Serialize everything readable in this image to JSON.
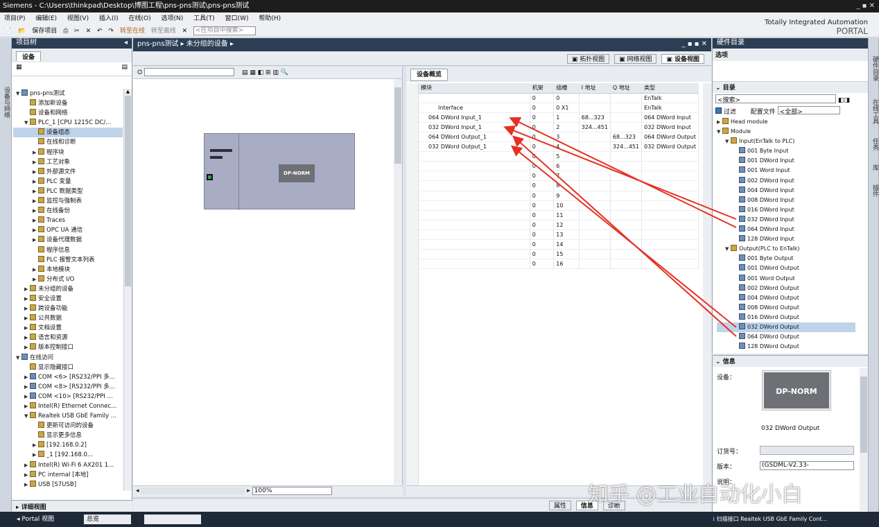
{
  "app": {
    "title": "Siemens  -  C:\\Users\\thinkpad\\Desktop\\博图工程\\pns-pns测试\\pns-pns测试",
    "window_controls": "_ ▪ ✕",
    "brand_line1": "Totally Integrated Automation",
    "brand_line2": "PORTAL"
  },
  "menu": [
    "项目(P)",
    "编辑(E)",
    "视图(V)",
    "插入(I)",
    "在线(O)",
    "选项(N)",
    "工具(T)",
    "窗口(W)",
    "帮助(H)"
  ],
  "toolbar": {
    "save": "保存项目",
    "go_online": "转至在线",
    "go_offline": "转至离线",
    "search_placeholder": "<在项目中搜索>"
  },
  "project_tree": {
    "header": "项目树",
    "tab": "设备",
    "items": [
      {
        "label": "pns-pns测试",
        "level": 0,
        "exp": "▼"
      },
      {
        "label": "添加新设备",
        "level": 1,
        "exp": ""
      },
      {
        "label": "设备和网络",
        "level": 1,
        "exp": ""
      },
      {
        "label": "PLC_1 [CPU 1215C DC/...",
        "level": 1,
        "exp": "▼"
      },
      {
        "label": "设备组态",
        "level": 2,
        "exp": "",
        "sel": true
      },
      {
        "label": "在线和诊断",
        "level": 2,
        "exp": ""
      },
      {
        "label": "程序块",
        "level": 2,
        "exp": "▶"
      },
      {
        "label": "工艺对象",
        "level": 2,
        "exp": "▶"
      },
      {
        "label": "外部源文件",
        "level": 2,
        "exp": "▶"
      },
      {
        "label": "PLC 变量",
        "level": 2,
        "exp": "▶"
      },
      {
        "label": "PLC 数据类型",
        "level": 2,
        "exp": "▶"
      },
      {
        "label": "监控与强制表",
        "level": 2,
        "exp": "▶"
      },
      {
        "label": "在线备份",
        "level": 2,
        "exp": "▶"
      },
      {
        "label": "Traces",
        "level": 2,
        "exp": "▶"
      },
      {
        "label": "OPC UA 通信",
        "level": 2,
        "exp": "▶"
      },
      {
        "label": "设备代理数据",
        "level": 2,
        "exp": "▶"
      },
      {
        "label": "程序信息",
        "level": 2,
        "exp": ""
      },
      {
        "label": "PLC 报警文本列表",
        "level": 2,
        "exp": ""
      },
      {
        "label": "本地模块",
        "level": 2,
        "exp": "▶"
      },
      {
        "label": "分布式 I/O",
        "level": 2,
        "exp": "▶"
      },
      {
        "label": "未分组的设备",
        "level": 1,
        "exp": "▶"
      },
      {
        "label": "安全设置",
        "level": 1,
        "exp": "▶"
      },
      {
        "label": "跨设备功能",
        "level": 1,
        "exp": "▶"
      },
      {
        "label": "公共数据",
        "level": 1,
        "exp": "▶"
      },
      {
        "label": "文档设置",
        "level": 1,
        "exp": "▶"
      },
      {
        "label": "语言和资源",
        "level": 1,
        "exp": "▶"
      },
      {
        "label": "版本控制接口",
        "level": 1,
        "exp": "▶"
      },
      {
        "label": "在线访问",
        "level": 0,
        "exp": "▼"
      },
      {
        "label": "显示隐藏接口",
        "level": 1,
        "exp": ""
      },
      {
        "label": "COM <6> [RS232/PPI 多...",
        "level": 1,
        "exp": "▶"
      },
      {
        "label": "COM <8> [RS232/PPI 多...",
        "level": 1,
        "exp": "▶"
      },
      {
        "label": "COM <10> [RS232/PPI ...",
        "level": 1,
        "exp": "▶"
      },
      {
        "label": "Intel(R) Ethernet Connec...",
        "level": 1,
        "exp": "▶"
      },
      {
        "label": "Realtek USB GbE Family ...",
        "level": 1,
        "exp": "▼"
      },
      {
        "label": "更新可访问的设备",
        "level": 2,
        "exp": ""
      },
      {
        "label": "显示更多信息",
        "level": 2,
        "exp": ""
      },
      {
        "label": "[192.168.0.2]",
        "level": 2,
        "exp": "▶"
      },
      {
        "label": "_1 [192.168.0...",
        "level": 2,
        "exp": "▶"
      },
      {
        "label": "Intel(R) Wi-Fi 6 AX201 1...",
        "level": 1,
        "exp": "▶"
      },
      {
        "label": "PC internal [本地]",
        "level": 1,
        "exp": "▶"
      },
      {
        "label": "USB [S7USB]",
        "level": 1,
        "exp": "▶"
      }
    ],
    "details": "详细视图",
    "side_label": "设备与网络"
  },
  "editor": {
    "breadcrumb": [
      "pns-pns测试",
      "未分组的设备"
    ],
    "views": [
      "拓扑视图",
      "网络视图",
      "设备视图"
    ],
    "device_block": "DP-NORM",
    "zoom": "100%"
  },
  "overview": {
    "tab": "设备概览",
    "columns": [
      "模块",
      "机架",
      "插槽",
      "I 地址",
      "Q 地址",
      "类型"
    ],
    "rows": [
      {
        "module": "",
        "rack": "0",
        "slot": "0",
        "i": "",
        "q": "",
        "type": "EnTalk",
        "indent": 1
      },
      {
        "module": "Interface",
        "rack": "0",
        "slot": "0 X1",
        "i": "",
        "q": "",
        "type": "EnTalk",
        "indent": 2
      },
      {
        "module": "064 DWord Input_1",
        "rack": "0",
        "slot": "1",
        "i": "68...323",
        "q": "",
        "type": "064 DWord Input",
        "indent": 1
      },
      {
        "module": "032 DWord Input_1",
        "rack": "0",
        "slot": "2",
        "i": "324...451",
        "q": "",
        "type": "032 DWord Input",
        "indent": 1
      },
      {
        "module": "064 DWord Output_1",
        "rack": "0",
        "slot": "3",
        "i": "",
        "q": "68...323",
        "type": "064 DWord Output",
        "indent": 1
      },
      {
        "module": "032 DWord Output_1",
        "rack": "0",
        "slot": "4",
        "i": "",
        "q": "324...451",
        "type": "032 DWord Output",
        "indent": 1
      },
      {
        "module": "",
        "rack": "0",
        "slot": "5",
        "i": "",
        "q": "",
        "type": "",
        "indent": 1
      },
      {
        "module": "",
        "rack": "0",
        "slot": "6",
        "i": "",
        "q": "",
        "type": "",
        "indent": 1
      },
      {
        "module": "",
        "rack": "0",
        "slot": "7",
        "i": "",
        "q": "",
        "type": "",
        "indent": 1
      },
      {
        "module": "",
        "rack": "0",
        "slot": "8",
        "i": "",
        "q": "",
        "type": "",
        "indent": 1
      },
      {
        "module": "",
        "rack": "0",
        "slot": "9",
        "i": "",
        "q": "",
        "type": "",
        "indent": 1
      },
      {
        "module": "",
        "rack": "0",
        "slot": "10",
        "i": "",
        "q": "",
        "type": "",
        "indent": 1
      },
      {
        "module": "",
        "rack": "0",
        "slot": "11",
        "i": "",
        "q": "",
        "type": "",
        "indent": 1
      },
      {
        "module": "",
        "rack": "0",
        "slot": "12",
        "i": "",
        "q": "",
        "type": "",
        "indent": 1
      },
      {
        "module": "",
        "rack": "0",
        "slot": "13",
        "i": "",
        "q": "",
        "type": "",
        "indent": 1
      },
      {
        "module": "",
        "rack": "0",
        "slot": "14",
        "i": "",
        "q": "",
        "type": "",
        "indent": 1
      },
      {
        "module": "",
        "rack": "0",
        "slot": "15",
        "i": "",
        "q": "",
        "type": "",
        "indent": 1
      },
      {
        "module": "",
        "rack": "0",
        "slot": "16",
        "i": "",
        "q": "",
        "type": "",
        "indent": 1
      }
    ]
  },
  "catalog": {
    "header": "硬件目录",
    "options": "选项",
    "section": "目录",
    "search": "<搜索>",
    "filter": "过滤",
    "config_label": "配置文件",
    "config_value": "<全部>",
    "items": [
      {
        "label": "Head module",
        "level": 0,
        "exp": "▶"
      },
      {
        "label": "Module",
        "level": 0,
        "exp": "▼"
      },
      {
        "label": "Input(EnTalk to PLC)",
        "level": 1,
        "exp": "▼"
      },
      {
        "label": "001 Byte Input",
        "level": 2,
        "exp": ""
      },
      {
        "label": "001 DWord Input",
        "level": 2,
        "exp": ""
      },
      {
        "label": "001 Word Input",
        "level": 2,
        "exp": ""
      },
      {
        "label": "002 DWord Input",
        "level": 2,
        "exp": ""
      },
      {
        "label": "004 DWord Input",
        "level": 2,
        "exp": ""
      },
      {
        "label": "008 DWord Input",
        "level": 2,
        "exp": ""
      },
      {
        "label": "016 DWord Input",
        "level": 2,
        "exp": ""
      },
      {
        "label": "032 DWord Input",
        "level": 2,
        "exp": ""
      },
      {
        "label": "064 DWord Input",
        "level": 2,
        "exp": ""
      },
      {
        "label": "128 DWord Input",
        "level": 2,
        "exp": ""
      },
      {
        "label": "Output(PLC to EnTalk)",
        "level": 1,
        "exp": "▼"
      },
      {
        "label": "001 Byte Output",
        "level": 2,
        "exp": ""
      },
      {
        "label": "001 DWord Output",
        "level": 2,
        "exp": ""
      },
      {
        "label": "001 Word Output",
        "level": 2,
        "exp": ""
      },
      {
        "label": "002 DWord Output",
        "level": 2,
        "exp": ""
      },
      {
        "label": "004 DWord Output",
        "level": 2,
        "exp": ""
      },
      {
        "label": "008 DWord Output",
        "level": 2,
        "exp": ""
      },
      {
        "label": "016 DWord Output",
        "level": 2,
        "exp": ""
      },
      {
        "label": "032 DWord Output",
        "level": 2,
        "exp": "",
        "sel": true
      },
      {
        "label": "064 DWord Output",
        "level": 2,
        "exp": ""
      },
      {
        "label": "128 DWord Output",
        "level": 2,
        "exp": ""
      }
    ],
    "side_tabs": [
      "硬件目录",
      "在线工具",
      "任务",
      "库",
      "插件"
    ]
  },
  "info": {
    "header": "信息",
    "device_label": "设备：",
    "device_name": "DP-NORM",
    "module": "032 DWord Output",
    "order_label": "订货号：",
    "version_label": "版本：",
    "version_value": "(GSDML-V2.33-",
    "desc_label": "说明："
  },
  "statusbar": {
    "portal": "Portal 视图",
    "overview": "总览",
    "props": "属性",
    "info": "信息",
    "diag": "诊断",
    "message": "扫描接口 Realtek USB GbE Family Cont..."
  },
  "watermark": "知乎 @工业自动化小白",
  "colors": {
    "panel": "#2c3e54",
    "selection": "#bfd3ea",
    "arrow": "#e53123"
  }
}
